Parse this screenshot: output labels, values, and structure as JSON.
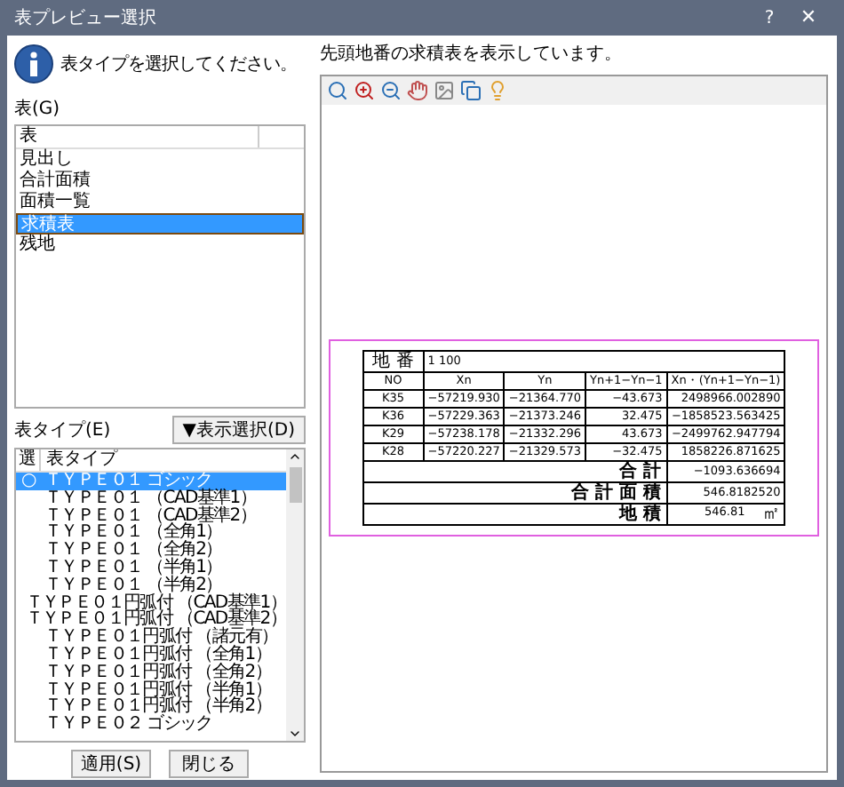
{
  "window": {
    "title": "表プレビュー選択",
    "help": "?",
    "close": "✕"
  },
  "prompt": "表タイプを選択してください。",
  "table_list": {
    "label": "表(G)",
    "header": "表",
    "items": [
      {
        "label": "見出し",
        "selected": false
      },
      {
        "label": "合計面積",
        "selected": false
      },
      {
        "label": "面積一覧",
        "selected": false
      },
      {
        "label": "求積表",
        "selected": true
      },
      {
        "label": "残地",
        "selected": false
      }
    ]
  },
  "type_list": {
    "label": "表タイプ(E)",
    "display_button": "▼表示選択(D)",
    "columns": [
      "選",
      "表タイプ"
    ],
    "rows": [
      {
        "mark": "○",
        "label": "ＴＹＰＥ０１ ゴシック",
        "selected": true
      },
      {
        "label": "ＴＹＰＥ０１ （CAD基準1）",
        "selected": false
      },
      {
        "label": "ＴＹＰＥ０１ （CAD基準2）",
        "selected": false
      },
      {
        "label": "ＴＹＰＥ０１ （全角1）",
        "selected": false
      },
      {
        "label": "ＴＹＰＥ０１ （全角2）",
        "selected": false
      },
      {
        "label": "ＴＹＰＥ０１ （半角1）",
        "selected": false
      },
      {
        "label": "ＴＹＰＥ０１ （半角2）",
        "selected": false
      },
      {
        "label": "ＴＹＰＥ０１円弧付 （CAD基準1）",
        "selected": false
      },
      {
        "label": "ＴＹＰＥ０１円弧付 （CAD基準2）",
        "selected": false
      },
      {
        "label": "ＴＹＰＥ０１円弧付 （諸元有）",
        "selected": false
      },
      {
        "label": "ＴＹＰＥ０１円弧付 （全角1）",
        "selected": false
      },
      {
        "label": "ＴＹＰＥ０１円弧付 （全角2）",
        "selected": false
      },
      {
        "label": "ＴＹＰＥ０１円弧付 （半角1）",
        "selected": false
      },
      {
        "label": "ＴＹＰＥ０１円弧付 （半角2）",
        "selected": false
      },
      {
        "label": "ＴＹＰＥ０２ ゴシック",
        "selected": false
      }
    ]
  },
  "buttons": [
    "適用(S)",
    "閉じる"
  ],
  "preview": {
    "message": "先頭地番の求積表を表示しています。",
    "sheet": {
      "lot_label": "地 番",
      "scale": "1 100",
      "columns": [
        "NO",
        "Xn",
        "Yn",
        "Yn+1−Yn−1",
        "Xn・(Yn+1−Yn−1)"
      ],
      "rows": [
        [
          "K35",
          "−57219.930",
          "−21364.770",
          "−43.673",
          "2498966.002890"
        ],
        [
          "K36",
          "−57229.363",
          "−21373.246",
          "32.475",
          "−1858523.563425"
        ],
        [
          "K29",
          "−57238.178",
          "−21332.296",
          "43.673",
          "−2499762.947794"
        ],
        [
          "K28",
          "−57220.227",
          "−21329.573",
          "−32.475",
          "1858226.871625"
        ]
      ],
      "totals": [
        {
          "label": "合 計",
          "value": "−1093.636694"
        },
        {
          "label": "合 計 面 積",
          "value": "546.8182520"
        },
        {
          "label": "地 積",
          "value": "546.81",
          "unit": "㎡"
        }
      ]
    }
  }
}
